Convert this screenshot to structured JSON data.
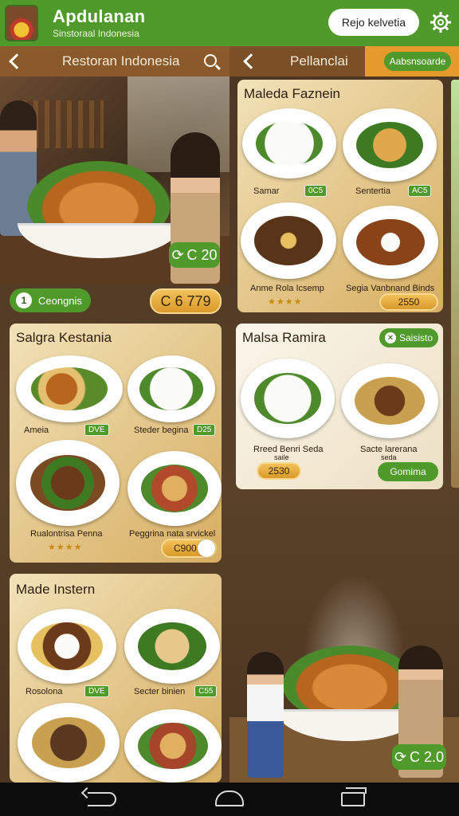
{
  "header": {
    "title": "Apdulanan",
    "subtitle": "Sinstoraal Indonesia",
    "lang_button": "Rejo kelvetia",
    "logo_icon": "restaurant-logo",
    "settings_icon": "gear-icon"
  },
  "left_bar": {
    "title": "Restoran Indonesia",
    "back_icon": "chevron-left-icon",
    "search_icon": "search-icon"
  },
  "right_bar": {
    "title": "Pellanclai",
    "back_icon": "chevron-left-icon",
    "action_label": "Aabsnsoarde"
  },
  "hero": {
    "price": "C 20",
    "price_icon": "tag-icon"
  },
  "category_pill": {
    "number": "1",
    "label": "Ceongnis"
  },
  "hero_total": "C 6 779",
  "card1": {
    "title": "Salgra Kestania",
    "dishes": [
      {
        "name": "Ameia",
        "price": "DVE"
      },
      {
        "name": "Steder begina",
        "price": "D25"
      },
      {
        "name": "Rualontrisa Penna",
        "rating": "★★★★"
      },
      {
        "name": "Peggrina nata srvickel",
        "price": "C900"
      }
    ]
  },
  "card2": {
    "title": "Made Instern",
    "dishes": [
      {
        "name": "Rosolona",
        "price": "DVE"
      },
      {
        "name": "Secter binien",
        "price": "C55"
      }
    ]
  },
  "card3": {
    "title": "Maleda Faznein",
    "dishes": [
      {
        "name": "Samar",
        "price": "0C5"
      },
      {
        "name": "Sentertia",
        "price": "AC5"
      },
      {
        "name": "Anme Rola Icsemp",
        "rating": "★★★★"
      },
      {
        "name": "Segia Vanbnand Binds",
        "price": "2550"
      }
    ]
  },
  "card4": {
    "title": "Malsa Ramira",
    "tag_label": "Saisisto",
    "tag_icon": "close-icon",
    "dishes": [
      {
        "name": "Rreed Benri Seda",
        "sub": "saile",
        "price": "2530"
      },
      {
        "name": "Sacte larerana",
        "sub": "seda",
        "button": "Gomima"
      }
    ]
  },
  "promo": {
    "price": "C 2.0",
    "price_icon": "tag-icon"
  },
  "colors": {
    "brand_green": "#4f9a2a",
    "accent_orange": "#e79a2c",
    "gold": "#d99a2a",
    "bar_brown": "#8a5a2b"
  },
  "navbar": {
    "back_icon": "back-icon",
    "home_icon": "home-icon",
    "recent_icon": "recent-apps-icon"
  }
}
